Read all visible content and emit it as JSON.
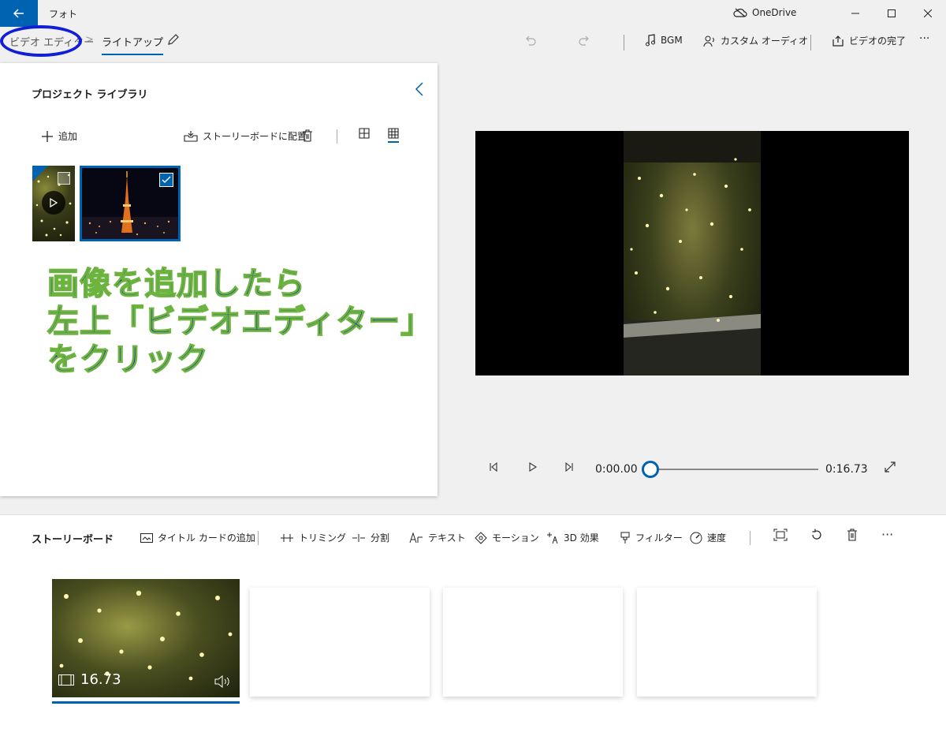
{
  "titlebar": {
    "app_title": "フォト",
    "onedrive_label": "OneDrive",
    "back_icon": "back-arrow-icon",
    "window_controls": [
      "minimize-icon",
      "maximize-icon",
      "close-icon"
    ]
  },
  "commandbar": {
    "breadcrumb_root": "ビデオ エディター",
    "breadcrumb_separator": ">",
    "breadcrumb_current": "ライトアップ",
    "bgm_label": "BGM",
    "custom_audio_label": "カスタム オーディオ",
    "finish_video_label": "ビデオの完了",
    "more_label": "···"
  },
  "library": {
    "title": "プロジェクト ライブラリ",
    "add_label": "追加",
    "place_on_storyboard_label": "ストーリーボードに配置",
    "items": [
      {
        "type": "video",
        "selected": false
      },
      {
        "type": "photo",
        "selected": true
      }
    ]
  },
  "annotation": {
    "line1": "画像を追加したら",
    "line2": "左上「ビデオエディター」",
    "line3": "をクリック",
    "text_color": "#1327c8",
    "outline_color": "#6db33f"
  },
  "player": {
    "current_time": "0:00.00",
    "total_time": "0:16.73",
    "progress": 0
  },
  "storyboard": {
    "title": "ストーリーボード",
    "tools": {
      "add_title_card": "タイトル カードの追加",
      "trim": "トリミング",
      "split": "分割",
      "text": "テキスト",
      "motion": "モーション",
      "effects_3d": "3D 効果",
      "filters": "フィルター",
      "speed": "速度",
      "more": "···"
    },
    "clips": [
      {
        "duration": "16.73",
        "selected": true
      }
    ],
    "empty_slots": 3
  },
  "colors": {
    "accent": "#0063b1",
    "annotation_circle": "#0e1fd6"
  }
}
